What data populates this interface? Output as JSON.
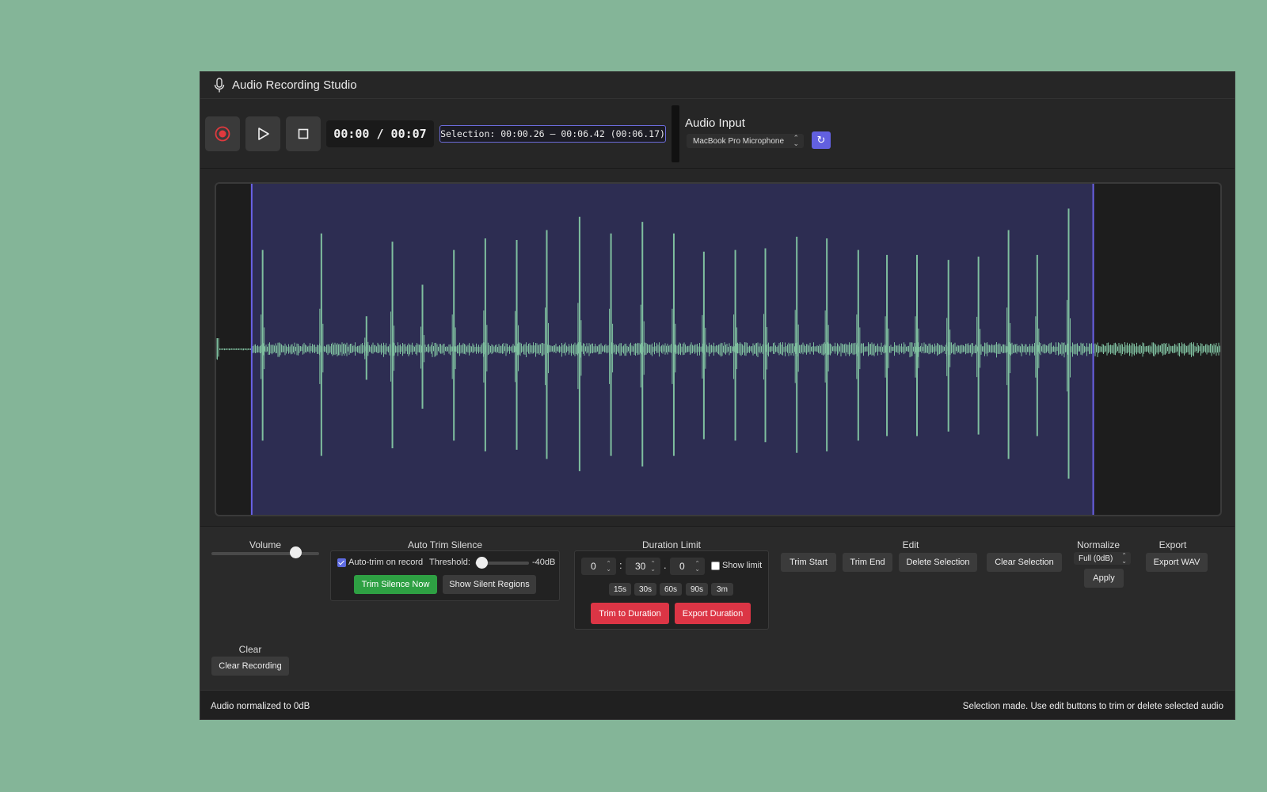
{
  "app": {
    "title": "Audio Recording Studio"
  },
  "transport": {
    "record_icon": "record-icon",
    "play_icon": "play-icon",
    "stop_icon": "stop-icon",
    "time_display": "00:00 / 00:07",
    "selection_display": "Selection: 00:00.26 – 00:06.42 (00:06.17)"
  },
  "audio_input": {
    "label": "Audio Input",
    "device": "MacBook Pro Microphone",
    "refresh_icon": "refresh-icon"
  },
  "waveform": {
    "duration_s": 7.35,
    "selection_start_s": 0.26,
    "selection_end_s": 6.42,
    "colors": {
      "wave": "#7fbf9f",
      "selection": "#2d2d52",
      "marker": "#6a62e8",
      "background": "#1d1d1d"
    },
    "peaks": [
      [
        0.34,
        0.6
      ],
      [
        0.77,
        0.7
      ],
      [
        1.1,
        0.2
      ],
      [
        1.29,
        0.65
      ],
      [
        1.51,
        0.39
      ],
      [
        1.74,
        0.6
      ],
      [
        1.97,
        0.67
      ],
      [
        2.2,
        0.66
      ],
      [
        2.42,
        0.72
      ],
      [
        2.66,
        0.8
      ],
      [
        2.89,
        0.7
      ],
      [
        3.12,
        0.77
      ],
      [
        3.35,
        0.7
      ],
      [
        3.57,
        0.59
      ],
      [
        3.8,
        0.6
      ],
      [
        4.02,
        0.61
      ],
      [
        4.25,
        0.68
      ],
      [
        4.47,
        0.67
      ],
      [
        4.7,
        0.6
      ],
      [
        4.91,
        0.57
      ],
      [
        5.13,
        0.57
      ],
      [
        5.36,
        0.54
      ],
      [
        5.58,
        0.56
      ],
      [
        5.8,
        0.72
      ],
      [
        6.01,
        0.57
      ],
      [
        6.24,
        0.85
      ]
    ]
  },
  "volume": {
    "label": "Volume",
    "level": 0.78
  },
  "auto_trim": {
    "label": "Auto Trim Silence",
    "checkbox_label": "Auto-trim on record",
    "checked": true,
    "threshold_label": "Threshold:",
    "threshold_value": "-40dB",
    "threshold_level": 0.12,
    "trim_now": "Trim Silence Now",
    "show_silent": "Show Silent Regions"
  },
  "duration_limit": {
    "label": "Duration Limit",
    "minutes": "0",
    "seconds": "30",
    "tenths": "0",
    "colon": ":",
    "dot": ".",
    "show_limit_label": "Show limit",
    "show_limit_checked": false,
    "presets": [
      "15s",
      "30s",
      "60s",
      "90s",
      "3m"
    ],
    "trim_to_duration": "Trim to Duration",
    "export_duration": "Export Duration"
  },
  "edit": {
    "label": "Edit",
    "trim_start": "Trim Start",
    "trim_end": "Trim End",
    "delete_selection": "Delete Selection",
    "clear_selection": "Clear Selection"
  },
  "normalize": {
    "label": "Normalize",
    "option": "Full (0dB)",
    "apply": "Apply"
  },
  "export": {
    "label": "Export",
    "export_wav": "Export WAV"
  },
  "clear": {
    "label": "Clear",
    "clear_recording": "Clear Recording"
  },
  "status": {
    "left": "Audio normalized to 0dB",
    "right": "Selection made. Use edit buttons to trim or delete selected audio"
  }
}
